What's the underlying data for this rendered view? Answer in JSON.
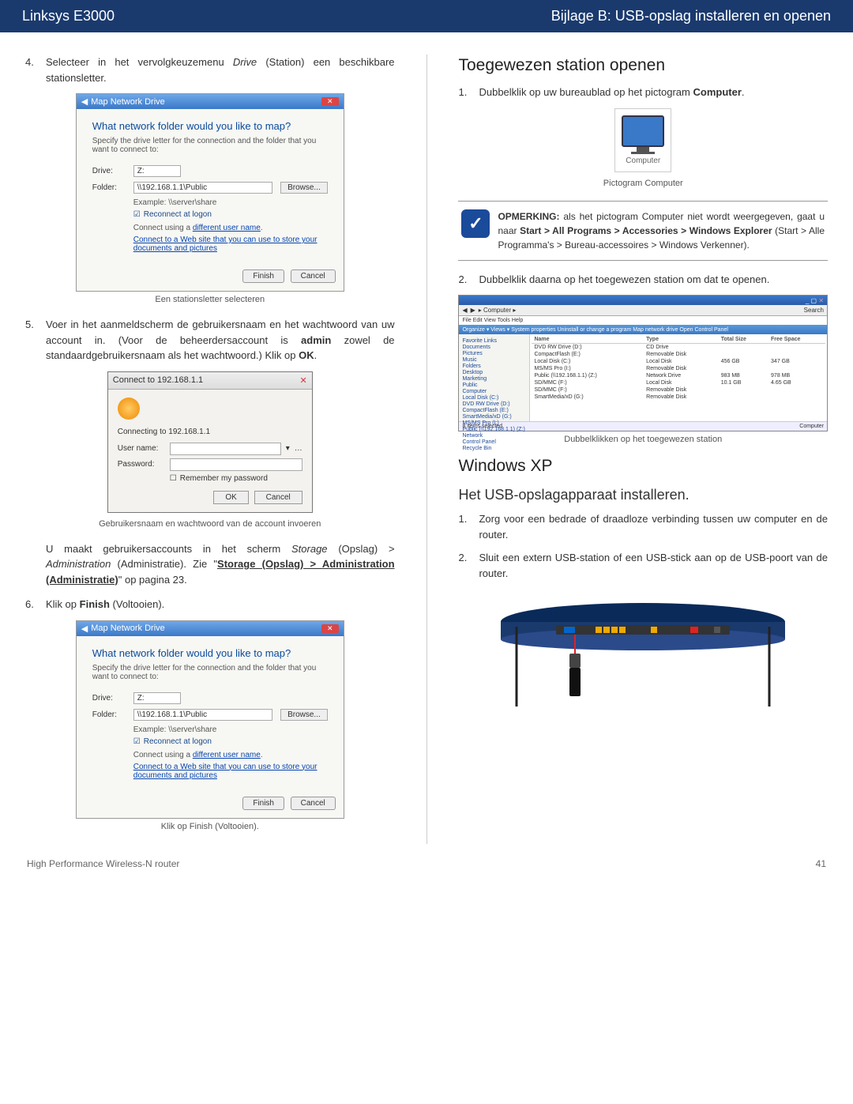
{
  "header": {
    "left": "Linksys E3000",
    "right": "Bijlage B: USB-opslag installeren en openen"
  },
  "left_col": {
    "step4": {
      "num": "4.",
      "text_a": "Selecteer in het vervolgkeuzemenu ",
      "text_em": "Drive",
      "text_b": " (Station) een beschikbare stationsletter."
    },
    "mapdlg": {
      "title": "Map Network Drive",
      "question": "What network folder would you like to map?",
      "sub": "Specify the drive letter for the connection and the folder that you want to connect to:",
      "drive_label": "Drive:",
      "drive_value": "Z:",
      "folder_label": "Folder:",
      "folder_value": "\\\\192.168.1.1\\Public",
      "browse": "Browse...",
      "example": "Example: \\\\server\\share",
      "reconnect": "Reconnect at logon",
      "diff_a": "Connect using a ",
      "diff_link": "different user name",
      "weblink": "Connect to a Web site that you can use to store your documents and pictures",
      "finish": "Finish",
      "cancel": "Cancel"
    },
    "caption1": "Een stationsletter selecteren",
    "step5": {
      "num": "5.",
      "text": "Voer in het aanmeldscherm de gebruikersnaam en het wachtwoord van uw account in. (Voor de beheerdersaccount is <strong>admin</strong> zowel de standaardgebruikersnaam als het wachtwoord.) Klik op <strong>OK</strong>."
    },
    "login": {
      "title": "Connect to 192.168.1.1",
      "connecting": "Connecting to 192.168.1.1",
      "user_label": "User name:",
      "pass_label": "Password:",
      "remember": "Remember my password",
      "ok": "OK",
      "cancel": "Cancel"
    },
    "caption2": "Gebruikersnaam en wachtwoord van de account invoeren",
    "para": "U maakt gebruikersaccounts in het scherm <em>Storage</em> (Opslag) > <em>Administration</em> (Administratie). Zie \"<strong><span class='link-u'>Storage (Opslag) > Administration (Administratie)</span></strong>\" op pagina 23.",
    "step6": {
      "num": "6.",
      "text": "Klik op <strong>Finish</strong> (Voltooien)."
    },
    "caption3": "Klik op Finish (Voltooien)."
  },
  "right_col": {
    "h2": "Toegewezen station openen",
    "step1": {
      "num": "1.",
      "text": "Dubbelklik op uw bureaublad op het pictogram <strong>Computer</strong>."
    },
    "computer_label": "Computer",
    "caption_computer": "Pictogram Computer",
    "note": "<strong>OPMERKING:</strong> als het pictogram Computer niet wordt weergegeven, gaat u naar <strong>Start > All Programs > Accessories > Windows Explorer</strong> (Start > Alle Programma's > Bureau-accessoires > Windows Verkenner).",
    "step2": {
      "num": "2.",
      "text": "Dubbelklik daarna op het toegewezen station om dat te openen."
    },
    "explorer": {
      "addr": "▸ Computer ▸",
      "menu": "File  Edit  View  Tools  Help",
      "toolbar": "Organize ▾   Views ▾   System properties   Uninstall or change a program   Map network drive   Open Control Panel",
      "side": [
        "Favorite Links",
        "Documents",
        "Pictures",
        "Music",
        "",
        "Folders",
        "Desktop",
        "Marketing",
        "Public",
        "Computer",
        "Local Disk (C:)",
        "DVD RW Drive (D:)",
        "CompactFlash (E:)",
        "SmartMedia/xD (G:)",
        "MS/MS Pro (I:)",
        "Public (\\\\192.168.1.1) (Z:)",
        "Network",
        "Control Panel",
        "Recycle Bin"
      ],
      "cols": [
        "Name",
        "Type",
        "Total Size",
        "Free Space"
      ],
      "rows": [
        [
          "DVD RW Drive (D:)",
          "CD Drive",
          "",
          ""
        ],
        [
          "CompactFlash (E:)",
          "Removable Disk",
          "",
          ""
        ],
        [
          "Local Disk (C:)",
          "Local Disk",
          "456 GB",
          "347 GB"
        ],
        [
          "MS/MS Pro (I:)",
          "Removable Disk",
          "",
          ""
        ],
        [
          "Public (\\\\192.168.1.1) (Z:)",
          "Network Drive",
          "983 MB",
          "978 MB"
        ],
        [
          "SD/MMC (F:)",
          "Local Disk",
          "10.1 GB",
          "4.65 GB"
        ],
        [
          "SD/MMC (F:)",
          "Removable Disk",
          "",
          ""
        ],
        [
          "SmartMedia/xD (G:)",
          "Removable Disk",
          "",
          ""
        ]
      ],
      "foot_left": "8 items selected",
      "foot_right": "Computer"
    },
    "caption_explorer": "Dubbelklikken op het toegewezen station",
    "h2b": "Windows XP",
    "h3": "Het USB-opslagapparaat installeren.",
    "xp1": {
      "num": "1.",
      "text": "Zorg voor een bedrade of draadloze verbinding tussen uw computer en de router."
    },
    "xp2": {
      "num": "2.",
      "text": "Sluit een extern USB-station of een USB-stick aan op de USB-poort van de router."
    }
  },
  "footer": {
    "left": "High Performance Wireless-N router",
    "right": "41"
  }
}
